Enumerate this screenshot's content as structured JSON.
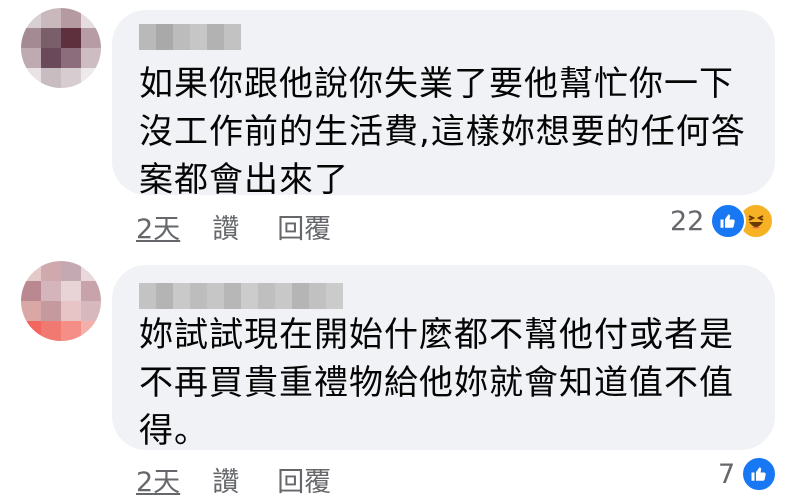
{
  "comments": [
    {
      "lines": [
        "如果你跟他說你失業了要他幫忙你一下",
        "沒工作前的生活費,這樣妳想要的任何答",
        "案都會出來了"
      ],
      "time": "2天",
      "like_label": "讚",
      "reply_label": "回覆",
      "reaction_count": "22",
      "reactions": [
        "like-icon",
        "haha-icon"
      ]
    },
    {
      "lines": [
        "妳試試現在開始什麼都不幫他付或者是",
        "不再買貴重禮物給他妳就會知道值不值",
        "得。"
      ],
      "time": "2天",
      "like_label": "讚",
      "reply_label": "回覆",
      "reaction_count": "7",
      "reactions": [
        "like-icon"
      ]
    }
  ],
  "colors": {
    "bubble": "#f0f2f5",
    "text": "#050505",
    "meta": "#65676b",
    "like": "#1877f2",
    "haha": "#f7b125"
  }
}
